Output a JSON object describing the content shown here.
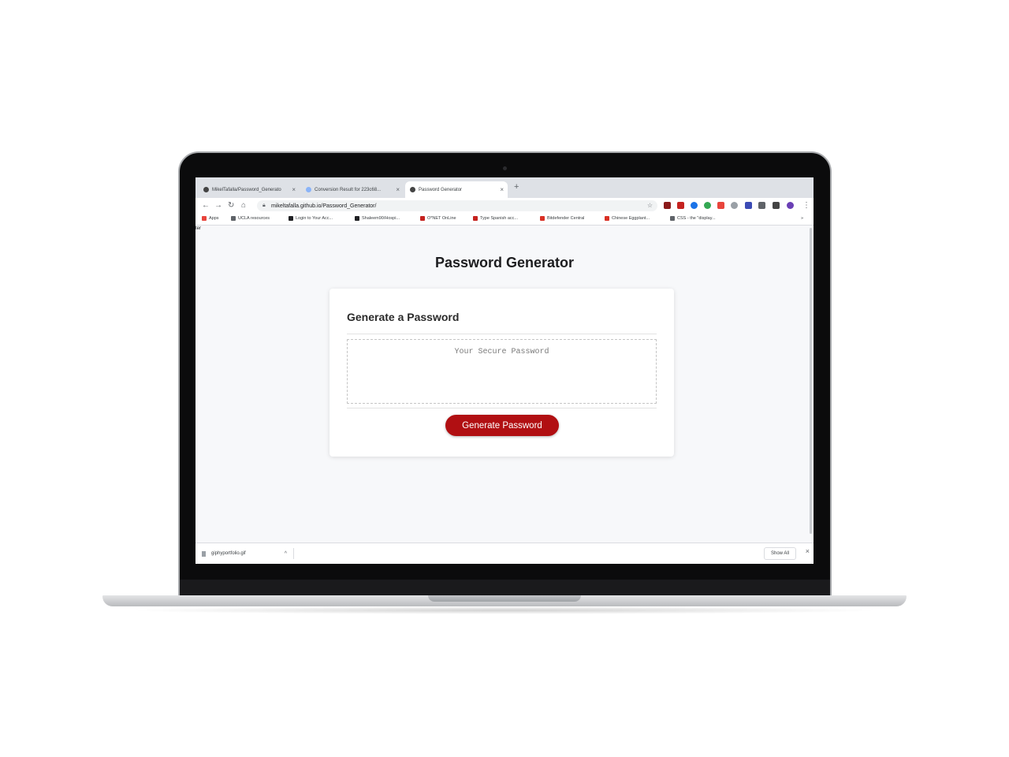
{
  "browser": {
    "tabs": [
      {
        "label": "MikelTafalla/Password_Generato",
        "active": false
      },
      {
        "label": "Conversion Result for 223c68...",
        "active": false
      },
      {
        "label": "Password Generator",
        "active": true
      }
    ],
    "new_tab": "+",
    "url": "mikeltafalla.github.io/Password_Generator/",
    "bookmarks": [
      {
        "label": "Apps",
        "color": "#e8453c"
      },
      {
        "label": "UCLA resources",
        "color": "#5f6368"
      },
      {
        "label": "Login to Your Acc...",
        "color": "#202124"
      },
      {
        "label": "Shaleem90/Hospi...",
        "color": "#202124"
      },
      {
        "label": "O*NET OnLine",
        "color": "#c5221f"
      },
      {
        "label": "Type Spanish acc...",
        "color": "#c5221f"
      },
      {
        "label": "Bitdefender Central",
        "color": "#d93025"
      },
      {
        "label": "Chinese Eggplant...",
        "color": "#d93025"
      },
      {
        "label": "CSS - the \"display...",
        "color": "#5f6368"
      }
    ],
    "corner_text": "ter",
    "extension_colors": [
      "#8b1a1a",
      "#c5221f",
      "#1a73e8",
      "#34a853",
      "#e8453c",
      "#9aa0a6",
      "#3c4bb5",
      "#5f6368",
      "#444444",
      "#6a3fb5"
    ]
  },
  "page": {
    "title": "Password Generator",
    "card_header": "Generate a Password",
    "password_placeholder": "Your Secure Password",
    "generate_button": "Generate Password"
  },
  "download_bar": {
    "file_name": "giphyportfolio.gif",
    "show_all": "Show All"
  },
  "colors": {
    "accent": "#b10f12",
    "page_background": "#f7f8fa"
  }
}
